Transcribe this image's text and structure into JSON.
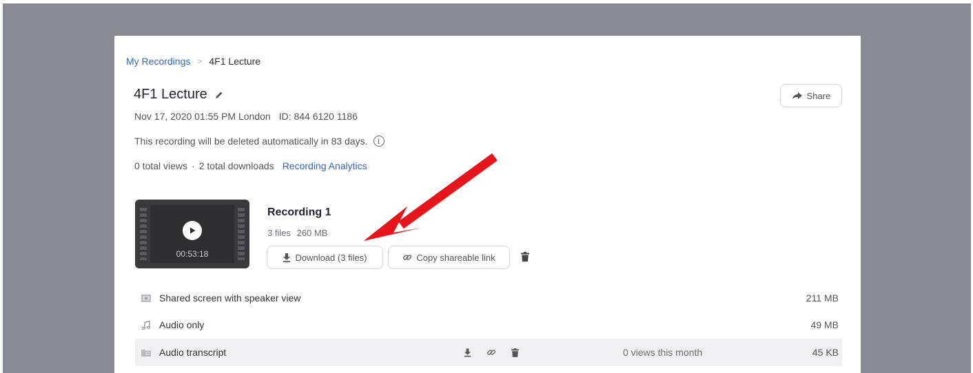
{
  "breadcrumb": {
    "parent": "My Recordings",
    "separator": ">",
    "current": "4F1 Lecture"
  },
  "meeting": {
    "title": "4F1 Lecture",
    "datetime": "Nov 17, 2020 01:55 PM London",
    "meeting_id": "ID: 844 6120 1186",
    "deletion_notice": "This recording will be deleted automatically in 83 days.",
    "views": "0 total views",
    "stats_separator": "·",
    "downloads": "2 total downloads",
    "analytics_link": "Recording Analytics"
  },
  "share": {
    "label": "Share"
  },
  "recording": {
    "title": "Recording 1",
    "file_count": "3 files",
    "total_size": "260 MB",
    "duration": "00:53:18",
    "download_label": "Download (3 files)",
    "copy_link_label": "Copy shareable link"
  },
  "files": [
    {
      "name": "Shared screen with speaker view",
      "size": "211 MB",
      "icon": "video-file-icon"
    },
    {
      "name": "Audio only",
      "size": "49 MB",
      "icon": "music-note-icon"
    },
    {
      "name": "Audio transcript",
      "size": "45 KB",
      "icon": "transcript-file-icon",
      "views": "0 views this month"
    }
  ],
  "colors": {
    "background_frame": "#8a8a94",
    "link": "#2d67c4",
    "annotation_arrow": "#e8141c"
  }
}
